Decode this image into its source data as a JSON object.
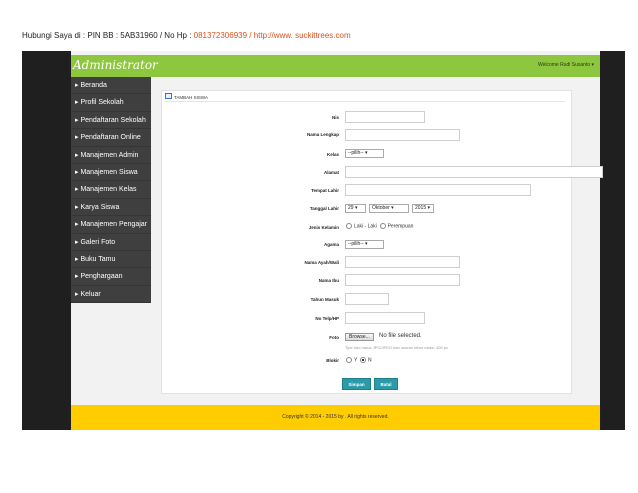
{
  "contact": {
    "prefix": "Hubungi Saya di : PIN BB : 5AB31960 / No Hp : ",
    "phone": "081372306939",
    "sep": " / ",
    "url": "http://www. suckittrees.com"
  },
  "header": {
    "brand": "Administrator",
    "welcome": "Welcome Rudi Susanto ▾"
  },
  "sidebar": {
    "items": [
      {
        "label": "▸ Beranda"
      },
      {
        "label": "▸ Profil Sekolah"
      },
      {
        "label": "▸ Pendaftaran Sekolah"
      },
      {
        "label": "▸ Pendaftaran Online"
      },
      {
        "label": "▸ Manajemen Admin"
      },
      {
        "label": "▸ Manajemen Siswa"
      },
      {
        "label": "▸ Manajemen Kelas"
      },
      {
        "label": "▸ Karya Siswa"
      },
      {
        "label": "▸ Manajemen Pengajar"
      },
      {
        "label": "▸ Galeri Foto"
      },
      {
        "label": "▸ Buku Tamu"
      },
      {
        "label": "▸ Penghargaan"
      },
      {
        "label": "▸ Keluar"
      }
    ]
  },
  "form": {
    "title": "Tambah Siswa",
    "labels": {
      "nis": "Nis",
      "nama": "Nama Lengkap",
      "kelas": "Kelas",
      "alamat": "Alamat",
      "tempat": "Tempat Lahir",
      "tanggal": "Tanggal Lahir",
      "jk": "Jenis Kelamin",
      "agama": "Agama",
      "ayah": "Nama Ayah/Wali",
      "ibu": "Nama Ibu",
      "tahun": "Tahun Masuk",
      "telp": "No Telp/HP",
      "foto": "Foto",
      "blokir": "Blokir"
    },
    "kelas_selected": "--pilih--",
    "agama_selected": "--pilih--",
    "tgl_day": "29",
    "tgl_month": "Oktober",
    "tgl_year": "2015",
    "jk_opt1": "Laki - Laki",
    "jk_opt2": "Perempuan",
    "browse": "Browse...",
    "no_file": "No file selected.",
    "hint": "Tipe foto harus JPG/JPEG dan ukuran lebar maks: 400 px",
    "blokir_y": "Y",
    "blokir_n": "N",
    "save": "Simpan",
    "cancel": "Batal"
  },
  "footer": {
    "text": "Copyright © 2014 - 2015 by . All rights reserved."
  },
  "colors": {
    "header": "#8dc63f",
    "sidebar": "#3f3f3f",
    "footer": "#ffcc00",
    "button": "#2c9aa8",
    "accent": "#d9531e"
  }
}
